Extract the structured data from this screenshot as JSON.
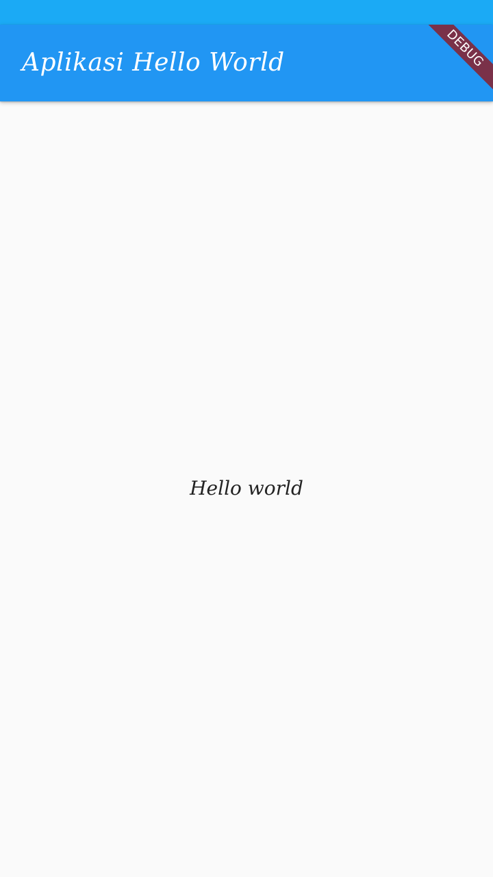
{
  "app_bar": {
    "title": "Aplikasi Hello World",
    "color": "#2196f3"
  },
  "status_bar": {
    "color": "#1baaf5"
  },
  "debug_banner": {
    "label": "DEBUG",
    "color": "#7a3149"
  },
  "main": {
    "text": "Hello world",
    "background": "#fafafa"
  }
}
